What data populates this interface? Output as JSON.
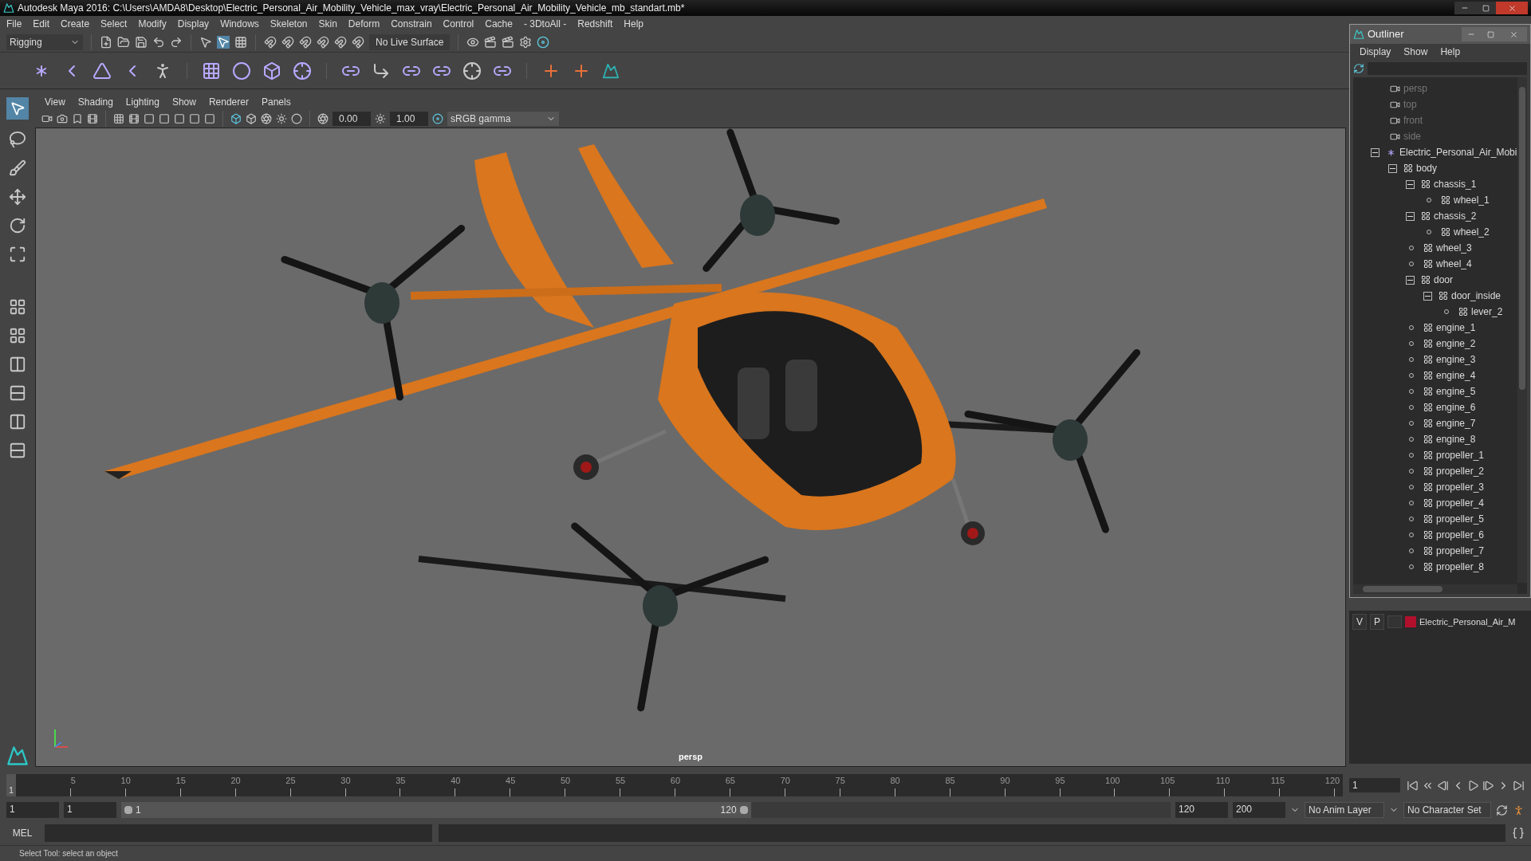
{
  "window": {
    "title": "Autodesk Maya 2016: C:\\Users\\AMDA8\\Desktop\\Electric_Personal_Air_Mobility_Vehicle_max_vray\\Electric_Personal_Air_Mobility_Vehicle_mb_standart.mb*"
  },
  "menu_bar": [
    "File",
    "Edit",
    "Create",
    "Select",
    "Modify",
    "Display",
    "Windows",
    "Skeleton",
    "Skin",
    "Deform",
    "Constrain",
    "Control",
    "Cache",
    "- 3DtoAll -",
    "Redshift",
    "Help"
  ],
  "status_line": {
    "mode": "Rigging",
    "live_surface": "No Live Surface"
  },
  "panel_menu": [
    "View",
    "Shading",
    "Lighting",
    "Show",
    "Renderer",
    "Panels"
  ],
  "panel_toolbar": {
    "exposure": "0.00",
    "gamma": "1.00",
    "color_space": "sRGB gamma"
  },
  "viewport": {
    "camera_label": "persp"
  },
  "outliner": {
    "title": "Outliner",
    "menu": [
      "Display",
      "Show",
      "Help"
    ],
    "tree": [
      {
        "label": "persp",
        "kind": "camera"
      },
      {
        "label": "top",
        "kind": "camera"
      },
      {
        "label": "front",
        "kind": "camera"
      },
      {
        "label": "side",
        "kind": "camera"
      },
      {
        "label": "Electric_Personal_Air_Mobi",
        "kind": "group",
        "expanded": true,
        "children": [
          {
            "label": "body",
            "kind": "mesh",
            "expanded": true,
            "children": [
              {
                "label": "chassis_1",
                "kind": "mesh",
                "expanded": true,
                "children": [
                  {
                    "label": "wheel_1",
                    "kind": "mesh"
                  }
                ]
              },
              {
                "label": "chassis_2",
                "kind": "mesh",
                "expanded": true,
                "children": [
                  {
                    "label": "wheel_2",
                    "kind": "mesh"
                  }
                ]
              },
              {
                "label": "wheel_3",
                "kind": "mesh"
              },
              {
                "label": "wheel_4",
                "kind": "mesh"
              },
              {
                "label": "door",
                "kind": "mesh",
                "expanded": true,
                "children": [
                  {
                    "label": "door_inside",
                    "kind": "mesh",
                    "expanded": true,
                    "children": [
                      {
                        "label": "lever_2",
                        "kind": "mesh"
                      }
                    ]
                  }
                ]
              },
              {
                "label": "engine_1",
                "kind": "mesh"
              },
              {
                "label": "engine_2",
                "kind": "mesh"
              },
              {
                "label": "engine_3",
                "kind": "mesh"
              },
              {
                "label": "engine_4",
                "kind": "mesh"
              },
              {
                "label": "engine_5",
                "kind": "mesh"
              },
              {
                "label": "engine_6",
                "kind": "mesh"
              },
              {
                "label": "engine_7",
                "kind": "mesh"
              },
              {
                "label": "engine_8",
                "kind": "mesh"
              },
              {
                "label": "propeller_1",
                "kind": "mesh"
              },
              {
                "label": "propeller_2",
                "kind": "mesh"
              },
              {
                "label": "propeller_3",
                "kind": "mesh"
              },
              {
                "label": "propeller_4",
                "kind": "mesh"
              },
              {
                "label": "propeller_5",
                "kind": "mesh"
              },
              {
                "label": "propeller_6",
                "kind": "mesh"
              },
              {
                "label": "propeller_7",
                "kind": "mesh"
              },
              {
                "label": "propeller_8",
                "kind": "mesh"
              }
            ]
          }
        ]
      }
    ]
  },
  "layer_editor": {
    "layers": [
      {
        "visible": "V",
        "playback": "P",
        "color": "#b0102c",
        "name": "Electric_Personal_Air_M"
      }
    ]
  },
  "timeline": {
    "ticks": [
      "5",
      "10",
      "15",
      "20",
      "25",
      "30",
      "35",
      "40",
      "45",
      "50",
      "55",
      "60",
      "65",
      "70",
      "75",
      "80",
      "85",
      "90",
      "95",
      "100",
      "105",
      "110",
      "115",
      "120"
    ],
    "current_frame": "1",
    "current_frame_field": "1"
  },
  "range_slider": {
    "level": 0.6,
    "start": "1",
    "playback_start": "1",
    "slider_start": "1",
    "slider_end": "120",
    "playback_end": "120",
    "end": "200",
    "anim_layer": "No Anim Layer",
    "character_set": "No Character Set"
  },
  "command_line": {
    "label": "MEL"
  },
  "help_line": "Select Tool: select an object"
}
